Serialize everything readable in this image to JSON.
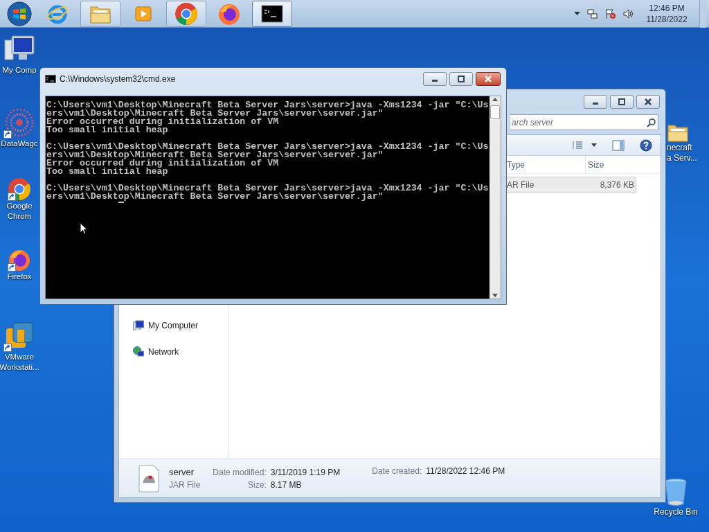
{
  "taskbar": {
    "items": [
      {
        "kind": "start",
        "running": false,
        "active": false
      },
      {
        "kind": "ie",
        "running": false,
        "active": false
      },
      {
        "kind": "explorer",
        "running": true,
        "active": false
      },
      {
        "kind": "media",
        "running": false,
        "active": false
      },
      {
        "kind": "chrome",
        "running": true,
        "active": false
      },
      {
        "kind": "firefox",
        "running": false,
        "active": false
      },
      {
        "kind": "cmd",
        "running": true,
        "active": true
      }
    ],
    "tray": {
      "time": "12:46 PM",
      "date": "11/28/2022"
    }
  },
  "desktop_icons": [
    {
      "kind": "computer",
      "lines": [
        "My Comp"
      ]
    },
    {
      "kind": "datawagon",
      "lines": [
        "DataWagc"
      ]
    },
    {
      "kind": "chrome",
      "lines": [
        "Google",
        "Chrom"
      ]
    },
    {
      "kind": "firefox",
      "lines": [
        "Firefox"
      ]
    },
    {
      "kind": "vmware",
      "lines": [
        "VMware",
        "Workstati..."
      ]
    },
    {
      "kind": "folder",
      "lines": [
        "necraft",
        "a Serv..."
      ]
    },
    {
      "kind": "recycle",
      "lines": [
        "Recycle Bin"
      ]
    }
  ],
  "explorer": {
    "search_placeholder": "arch server",
    "columns": [
      "Type",
      "Size"
    ],
    "rows": [
      {
        "type": "AR File",
        "size": "8,376 KB",
        "selected": true
      }
    ],
    "nav_items": [
      {
        "kind": "computer",
        "label": "My Computer"
      },
      {
        "kind": "network",
        "label": "Network"
      }
    ],
    "details": {
      "name": "server",
      "type": "JAR File",
      "fields": [
        {
          "label": "Date modified:",
          "value": "3/11/2019 1:19 PM"
        },
        {
          "label": "Size:",
          "value": "8.17 MB"
        },
        {
          "label": "Date created:",
          "value": "11/28/2022 12:46 PM"
        }
      ]
    }
  },
  "cmd": {
    "title": "C:\\Windows\\system32\\cmd.exe",
    "blocks": [
      [
        "C:\\Users\\vm1\\Desktop\\Minecraft Beta Server Jars\\server>java -Xms1234 -jar \"C:\\Us",
        "ers\\vm1\\Desktop\\Minecraft Beta Server Jars\\server\\server.jar\"",
        "Error occurred during initialization of VM",
        "Too small initial heap"
      ],
      [
        "C:\\Users\\vm1\\Desktop\\Minecraft Beta Server Jars\\server>java -Xmx1234 -jar \"C:\\Us",
        "ers\\vm1\\Desktop\\Minecraft Beta Server Jars\\server\\server.jar\"",
        "Error occurred during initialization of VM",
        "Too small initial heap"
      ],
      [
        "C:\\Users\\vm1\\Desktop\\Minecraft Beta Server Jars\\server>java -Xmx1234 -jar \"C:\\Us",
        "ers\\vm1\\Desktop\\Minecraft Beta Server Jars\\server\\server.jar\""
      ]
    ]
  }
}
